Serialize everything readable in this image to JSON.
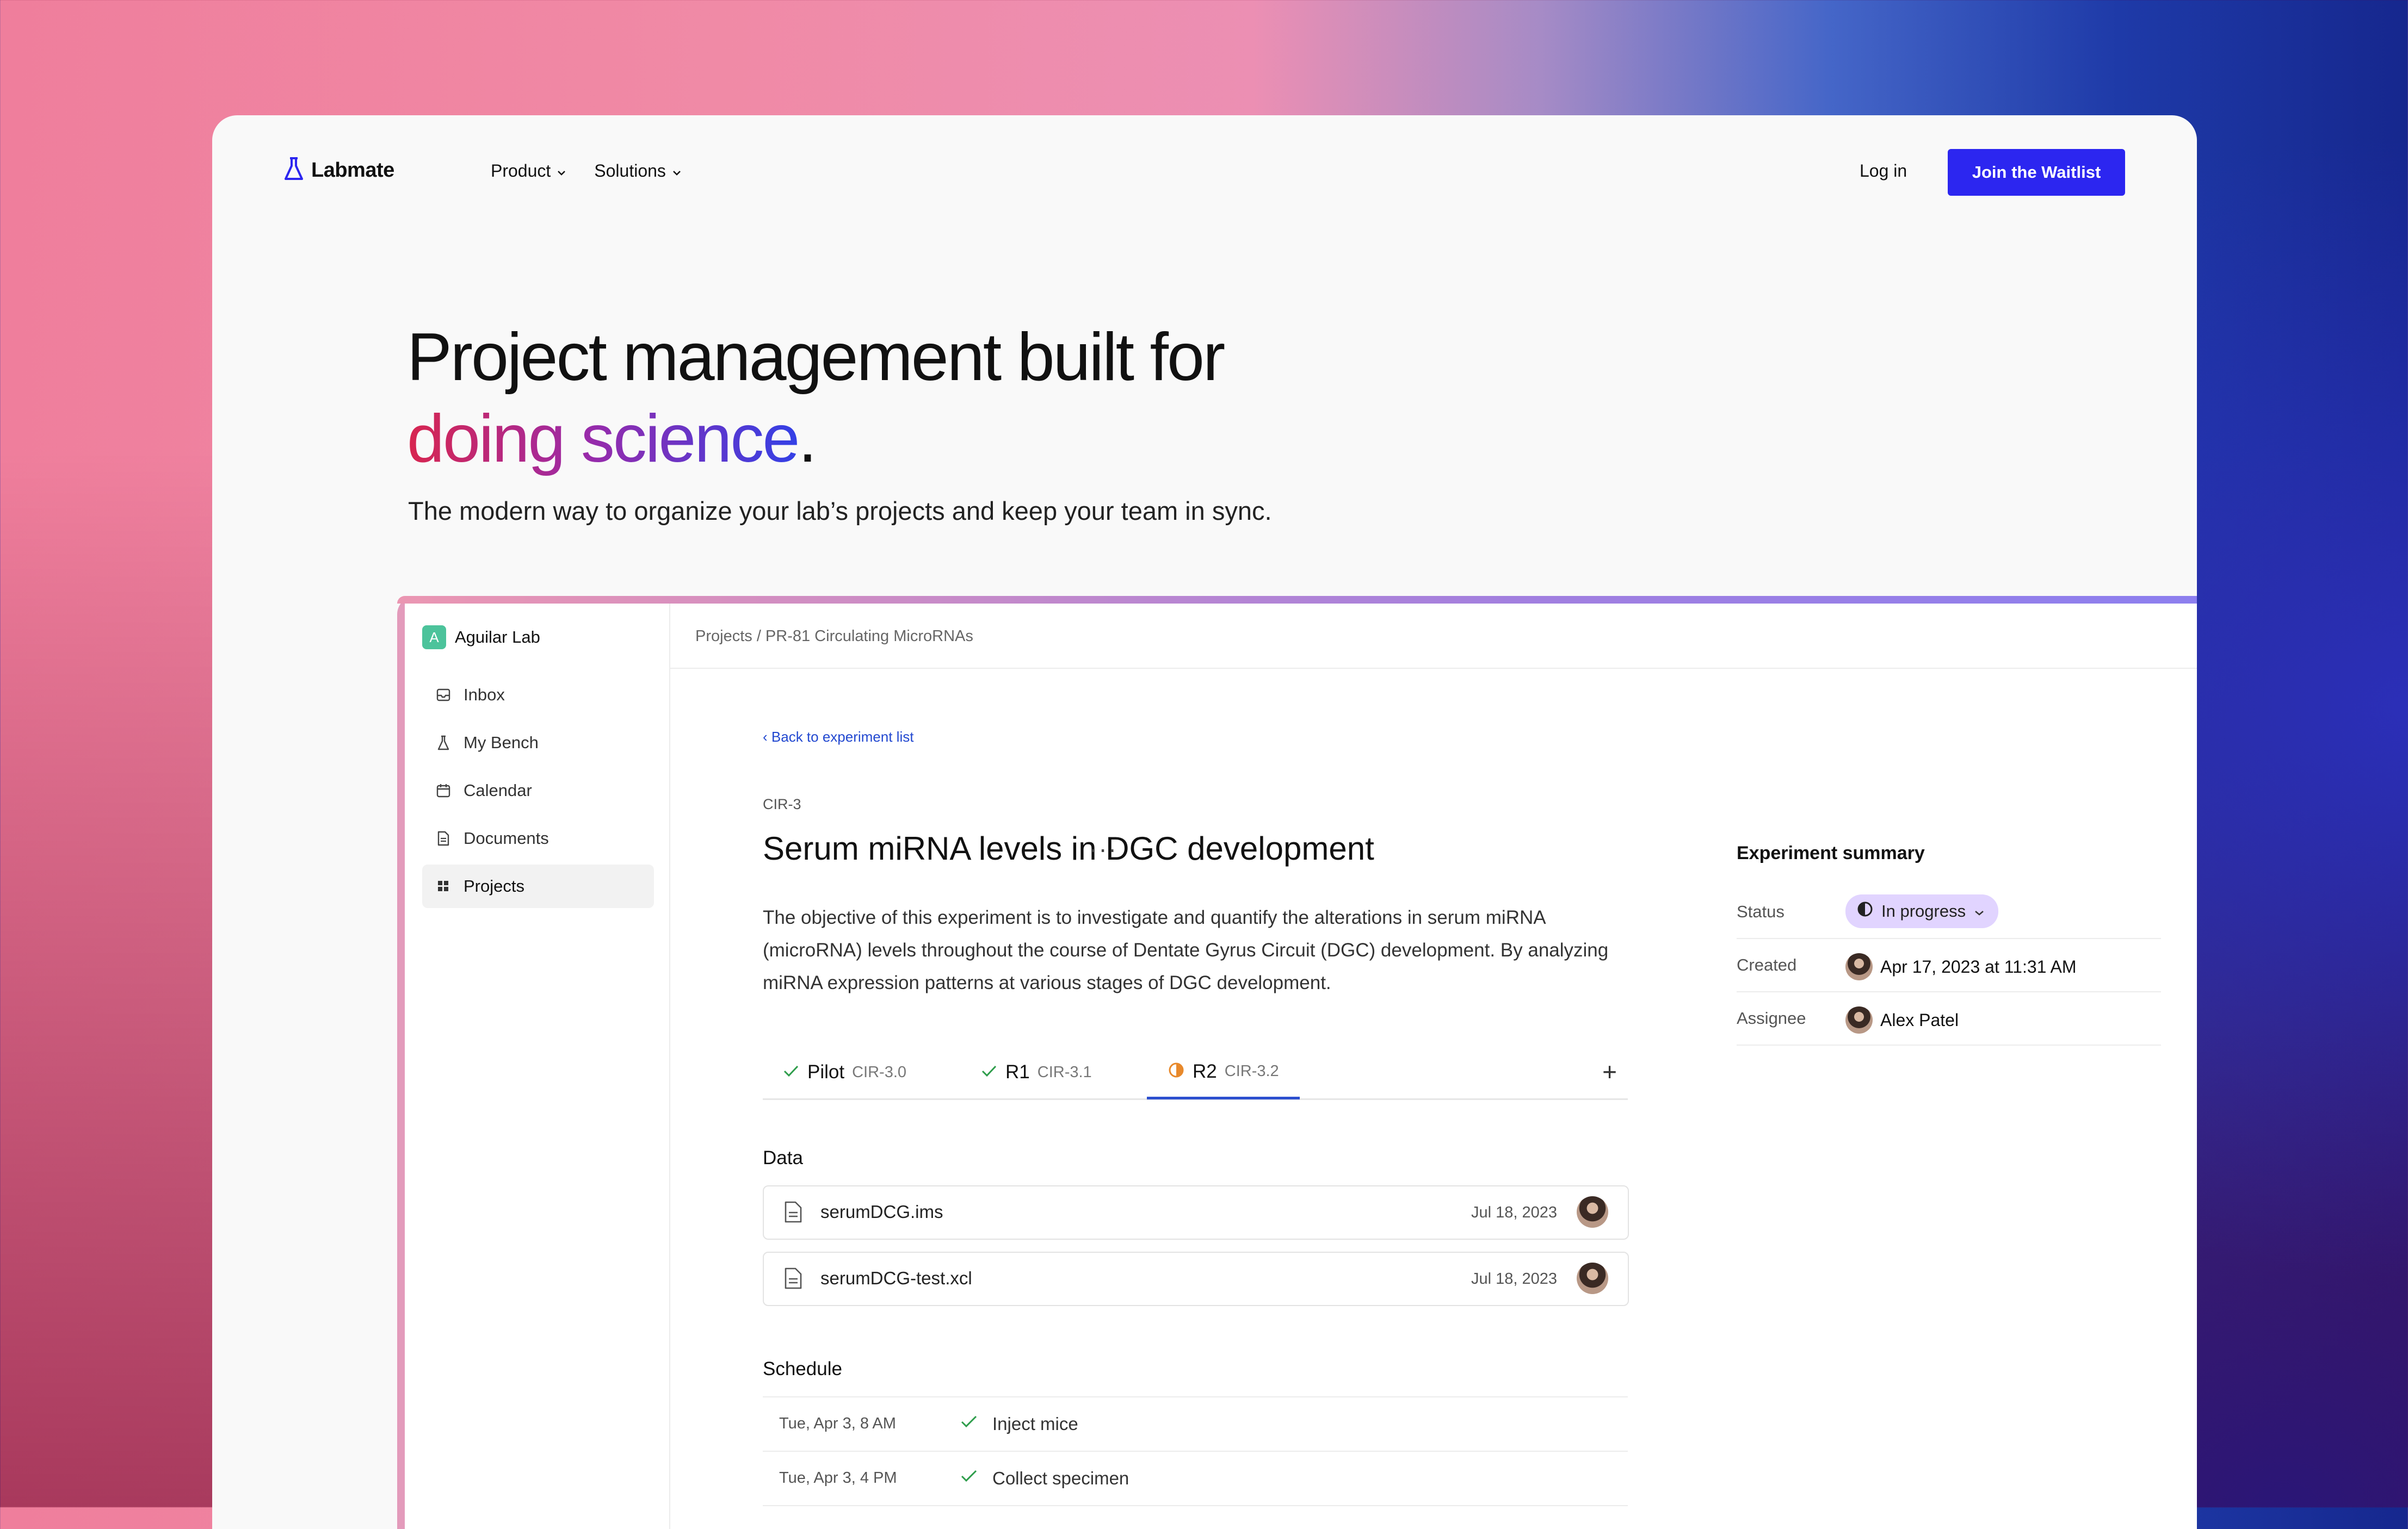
{
  "nav": {
    "brand": "Labmate",
    "menu": [
      {
        "label": "Product"
      },
      {
        "label": "Solutions"
      }
    ],
    "login": "Log in",
    "cta": "Join the Waitlist"
  },
  "hero": {
    "title_line1": "Project management built for",
    "title_accent": "doing science",
    "title_end": ".",
    "subtitle": "The modern way to organize your lab’s projects and keep your team in sync."
  },
  "app": {
    "workspace": {
      "badge": "A",
      "name": "Aguilar Lab"
    },
    "sidebar": [
      {
        "label": "Inbox",
        "icon": "inbox-icon"
      },
      {
        "label": "My Bench",
        "icon": "flask-icon"
      },
      {
        "label": "Calendar",
        "icon": "calendar-icon"
      },
      {
        "label": "Documents",
        "icon": "document-icon"
      },
      {
        "label": "Projects",
        "icon": "grid-icon",
        "active": true
      }
    ],
    "breadcrumb": "Projects / PR-81 Circulating MicroRNAs",
    "back_link": "Back to experiment list",
    "experiment": {
      "id": "CIR-3",
      "title": "Serum miRNA levels in DGC development",
      "more": "···",
      "description": "The objective of this experiment is to investigate and quantify the alterations in serum miRNA (microRNA) levels throughout the course of Dentate Gyrus Circuit (DGC) development. By analyzing miRNA expression patterns at various stages of DGC development."
    },
    "tabs": [
      {
        "label": "Pilot",
        "code": "CIR-3.0",
        "state": "done"
      },
      {
        "label": "R1",
        "code": "CIR-3.1",
        "state": "done"
      },
      {
        "label": "R2",
        "code": "CIR-3.2",
        "state": "in-progress",
        "active": true
      }
    ],
    "tab_add": "+",
    "data_heading": "Data",
    "files": [
      {
        "name": "serumDCG.ims",
        "date": "Jul 18, 2023"
      },
      {
        "name": "serumDCG-test.xcl",
        "date": "Jul 18, 2023"
      }
    ],
    "schedule_heading": "Schedule",
    "schedule": [
      {
        "time": "Tue, Apr 3, 8 AM",
        "task": "Inject mice"
      },
      {
        "time": "Tue, Apr 3, 4 PM",
        "task": "Collect specimen"
      }
    ],
    "summary": {
      "heading": "Experiment summary",
      "status_key": "Status",
      "status_value": "In progress",
      "created_key": "Created",
      "created_value": "Apr 17, 2023 at 11:31 AM",
      "assignee_key": "Assignee",
      "assignee_value": "Alex Patel"
    }
  },
  "colors": {
    "primary_button": "#2c26f0",
    "link": "#2248d0",
    "check_green": "#2e9d4b",
    "in_progress_orange": "#e8892b",
    "status_pill": "#e1d4ff",
    "workspace_badge": "#4cc39b"
  }
}
